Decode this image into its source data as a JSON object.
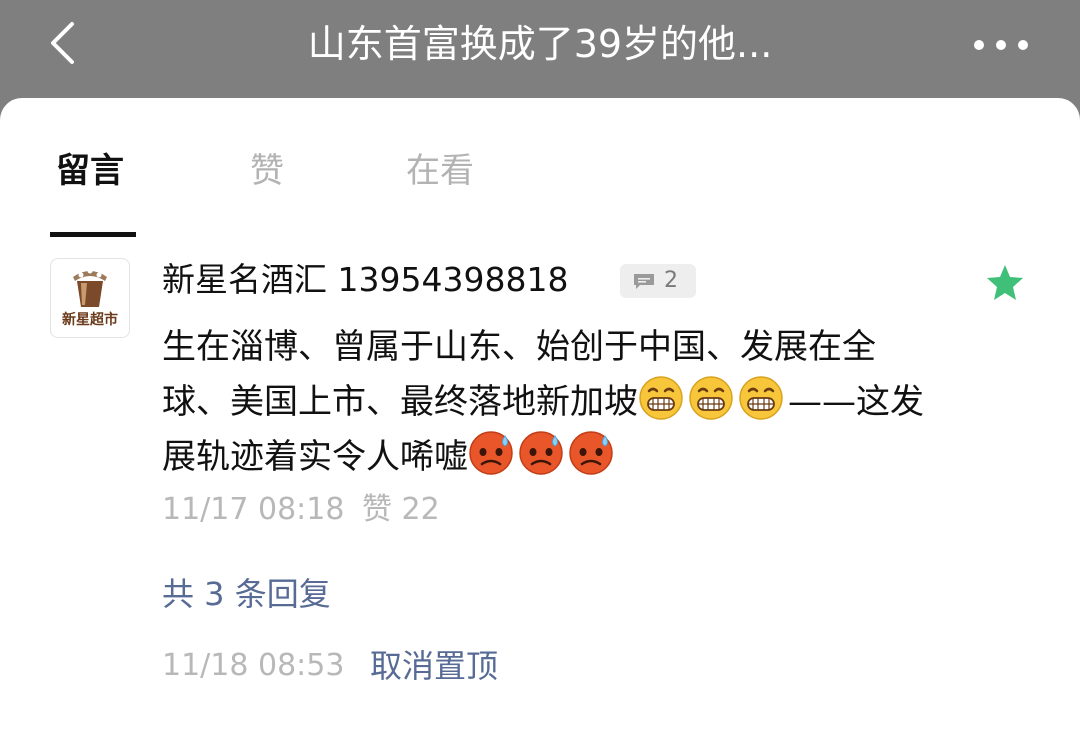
{
  "header": {
    "title": "山东首富换成了39岁的他...",
    "back_icon": "chevron-left-icon",
    "more_icon": "more-dots-icon"
  },
  "tabs": [
    {
      "label": "留言",
      "active": true
    },
    {
      "label": "赞",
      "active": false
    },
    {
      "label": "在看",
      "active": false
    }
  ],
  "comment": {
    "author": "新星名酒汇 13954398818",
    "avatar_text": "新星超市",
    "reply_count": "2",
    "starred": true,
    "star_color": "#3fbf77",
    "text_segments": [
      "生在淄博、曾属于山东、始创于中国、发展在全球、美国上市、最终落地新加坡",
      "——这发展轨迹着实令人唏嘘"
    ],
    "emoji_names": [
      "grin-emoji",
      "sweat-frown-emoji"
    ],
    "time": "11/17 08:18",
    "likes": "赞 22",
    "replies_link": "共 3 条回复",
    "pin_time": "11/18 08:53",
    "unpin_label": "取消置顶"
  },
  "colors": {
    "header_bg": "#7f7f7f",
    "link": "#576b95",
    "muted": "#b8b8b8"
  }
}
